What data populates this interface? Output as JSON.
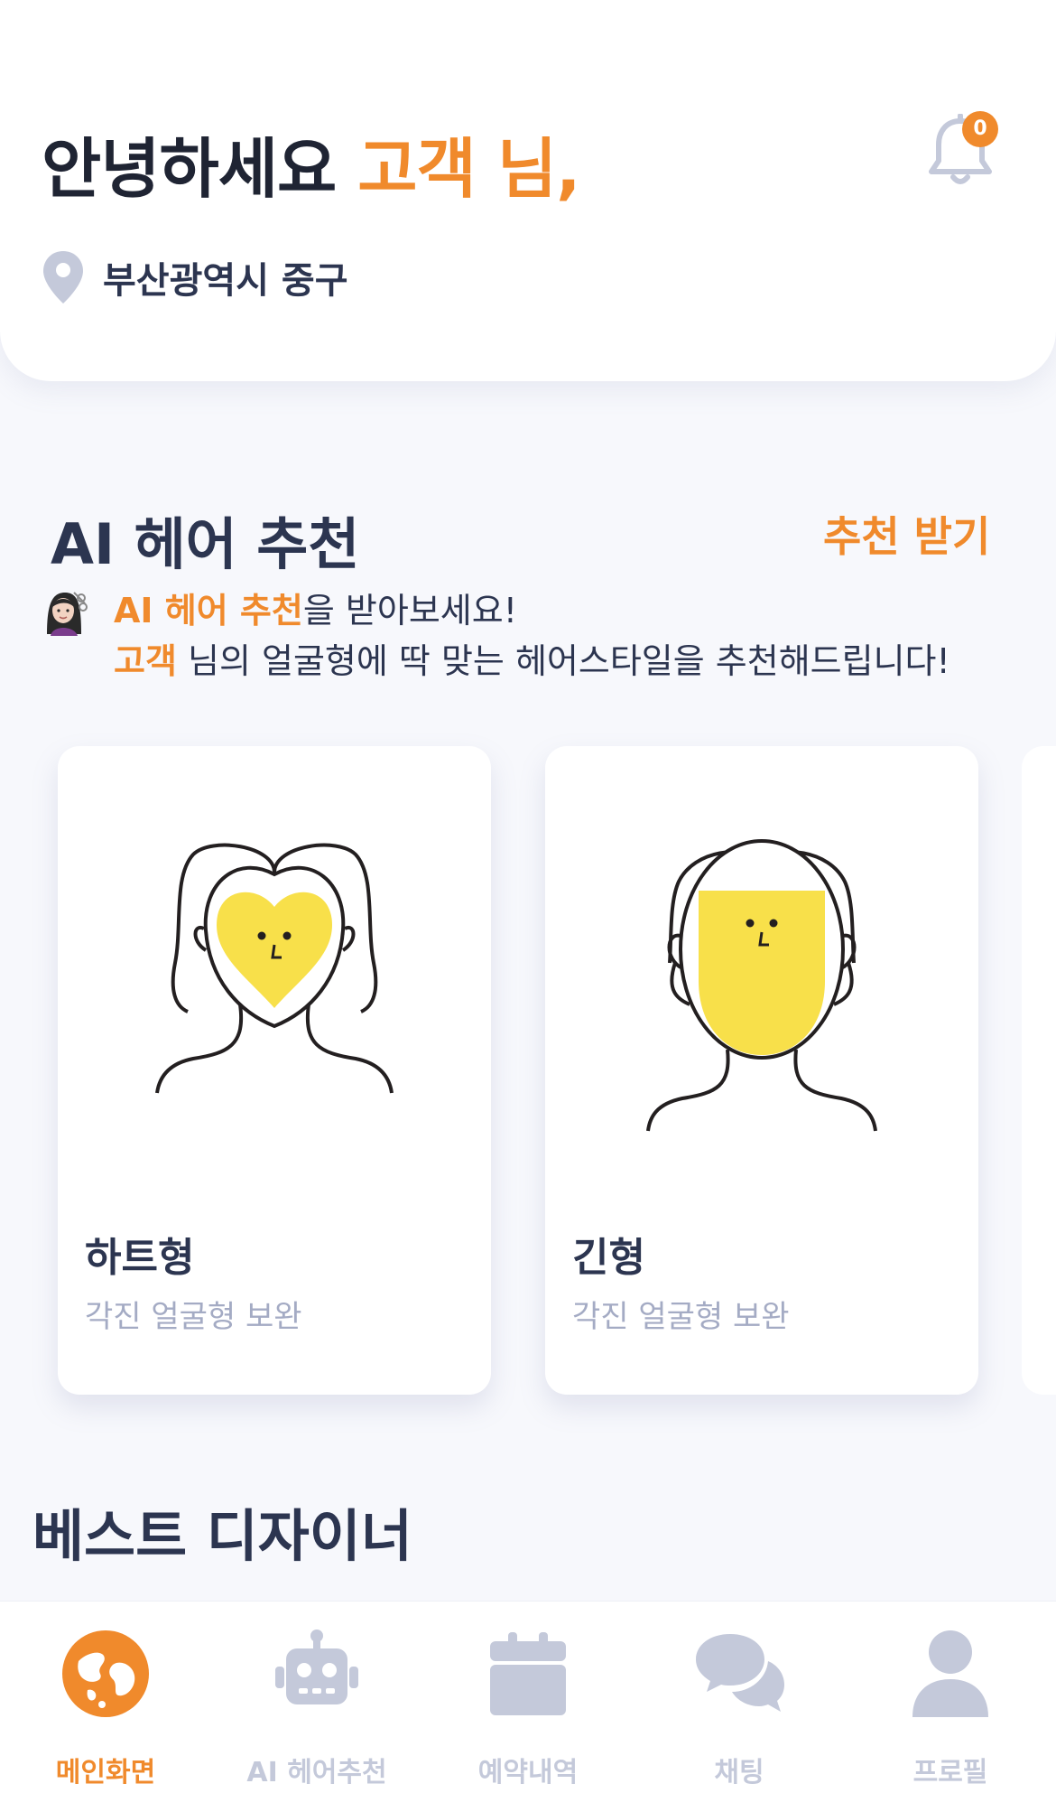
{
  "header": {
    "greeting_prefix": "안녕하세요",
    "user_name": "고객 님,",
    "notification_count": "0",
    "location": "부산광역시 중구"
  },
  "ai_section": {
    "title": "AI 헤어 추천",
    "action_label": "추천 받기",
    "intro_line1_highlight": "AI 헤어 추천",
    "intro_line1_rest": "을 받아보세요!",
    "intro_line2_highlight": "고객",
    "intro_line2_rest": " 님의 얼굴형에 딱 맞는 헤어스타일을 추천해드립니다!"
  },
  "face_cards": [
    {
      "title": "하트형",
      "subtitle": "각진 얼굴형 보완",
      "icon": "heart-face-icon"
    },
    {
      "title": "긴형",
      "subtitle": "각진 얼굴형 보완",
      "icon": "long-face-icon"
    }
  ],
  "best_designer": {
    "title": "베스트 디자이너"
  },
  "tabbar": {
    "items": [
      {
        "label": "메인화면",
        "icon": "globe-icon",
        "active": true
      },
      {
        "label": "AI 헤어추천",
        "icon": "robot-icon",
        "active": false
      },
      {
        "label": "예약내역",
        "icon": "calendar-icon",
        "active": false
      },
      {
        "label": "채팅",
        "icon": "chat-icon",
        "active": false
      },
      {
        "label": "프로필",
        "icon": "profile-icon",
        "active": false
      }
    ]
  },
  "colors": {
    "accent": "#f08a2c",
    "text_primary": "#2c3550",
    "text_muted": "#a4abc4",
    "icon_inactive": "#c4c9da",
    "face_fill": "#f8e04a",
    "background": "#f7f8fc"
  }
}
